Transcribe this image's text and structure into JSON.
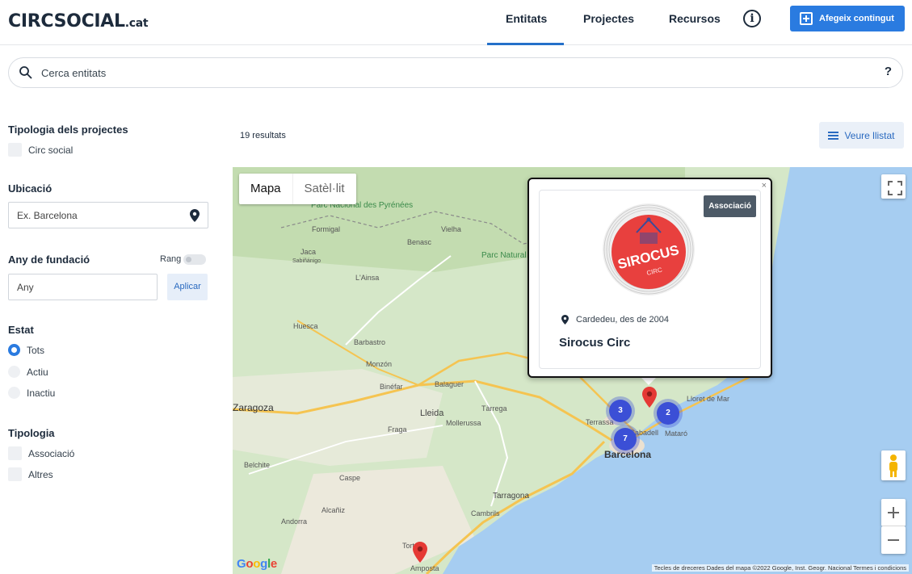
{
  "header": {
    "logo_main": "CIRCSOCIAL",
    "logo_tld": ".cat",
    "nav": [
      "Entitats",
      "Projectes",
      "Recursos"
    ],
    "info_label": "i",
    "add_button": "Afegeix contingut"
  },
  "search": {
    "placeholder": "Cerca entitats",
    "help": "?"
  },
  "filters": {
    "tipologia_projectes": {
      "title": "Tipologia dels projectes",
      "options": [
        "Circ social"
      ]
    },
    "ubicacio": {
      "title": "Ubicació",
      "placeholder": "Ex. Barcelona"
    },
    "any_fundacio": {
      "title": "Any de fundació",
      "rang_label": "Rang",
      "placeholder": "Any",
      "apply": "Aplicar"
    },
    "estat": {
      "title": "Estat",
      "options": [
        "Tots",
        "Actiu",
        "Inactiu"
      ],
      "selected": "Tots"
    },
    "tipologia": {
      "title": "Tipologia",
      "options": [
        "Associació",
        "Altres"
      ]
    }
  },
  "results": {
    "count_text": "19 resultats",
    "list_button": "Veure llistat"
  },
  "map": {
    "type_map": "Mapa",
    "type_satellite": "Satèl·lit",
    "clusters": [
      "3",
      "2",
      "7"
    ],
    "place_labels": [
      "Barcelona",
      "Lleida",
      "Tarragona",
      "Terrassa",
      "Sabadell",
      "Mataró",
      "Lloret de Mar",
      "Balaguer",
      "Tàrrega",
      "Mollerussa",
      "Fraga",
      "Monzón",
      "Barbastro",
      "Huesca",
      "Zaragoza",
      "Caspe",
      "Alcañiz",
      "Andorra",
      "Belchite",
      "Binéfar",
      "Cambrils",
      "Tortosa",
      "Amposta",
      "Vielha",
      "Formigal",
      "Jaca",
      "L'Ainsa",
      "Sabiñánigo",
      "Benasc",
      "Parc Nacional des Pyrénées",
      "Parc Natural de l'Alt Pirineu"
    ],
    "footer": "Tecles de dreceres   Dades del mapa ©2022 Google, Inst. Geogr. Nacional   Termes i condicions",
    "google": "Google"
  },
  "popup": {
    "close": "×",
    "tag": "Associació",
    "location": "Cardedeu, des de 2004",
    "name": "Sirocus Circ",
    "logo_text": "SIROCUS",
    "logo_sub": "CIRC"
  },
  "colors": {
    "accent": "#2a7be0",
    "brand_dark": "#1d2b3c",
    "sea": "#a6cdf1",
    "land": "#d5e7c8",
    "marker": "#e53935",
    "cluster": "#3b4fd6"
  }
}
